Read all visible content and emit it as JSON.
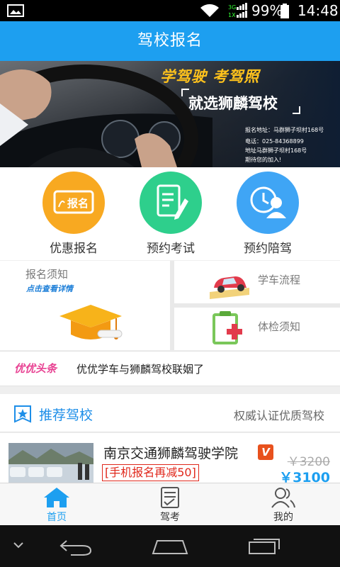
{
  "status_bar": {
    "network": "3G 1X",
    "battery_percent": "99%",
    "time": "14:48"
  },
  "header": {
    "title": "驾校报名"
  },
  "banner": {
    "slogan": "学驾驶 考驾照",
    "brand": "就选狮麟驾校",
    "address_line": "报名地址：马群狮子坝村168号",
    "phone_line": "电话：025-84368899",
    "addr_line2": "地址马群狮子坝村168号",
    "welcome_line": "期待您的加入!"
  },
  "entries": [
    {
      "label": "优惠报名",
      "badge": "报名",
      "icon": "signup-icon",
      "color": "#f8a921"
    },
    {
      "label": "预约考试",
      "icon": "exam-note-icon",
      "color": "#2ecf8c"
    },
    {
      "label": "预约陪驾",
      "icon": "clock-person-icon",
      "color": "#3fa5f5"
    }
  ],
  "info": {
    "notice_title": "报名须知",
    "notice_sub": "点击查看详情",
    "process": "学车流程",
    "health": "体检须知"
  },
  "headline": {
    "tag": "优优头条",
    "text": "优优学车与狮麟驾校联姻了"
  },
  "recommend": {
    "title": "推荐驾校",
    "right_text": "权威认证优质驾校"
  },
  "school": {
    "name": "南京交通狮麟驾驶学院",
    "verified_badge": "V",
    "promo": "[手机报名再减50]",
    "old_price": "￥3200",
    "price": "￥3100"
  },
  "tabs": [
    {
      "label": "首页",
      "icon": "home-icon",
      "active": true
    },
    {
      "label": "驾考",
      "icon": "checklist-icon",
      "active": false
    },
    {
      "label": "我的",
      "icon": "people-icon",
      "active": false
    }
  ],
  "colors": {
    "primary": "#1d9ff0",
    "promo_red": "#e0271b",
    "headline_pink": "#e84393"
  }
}
